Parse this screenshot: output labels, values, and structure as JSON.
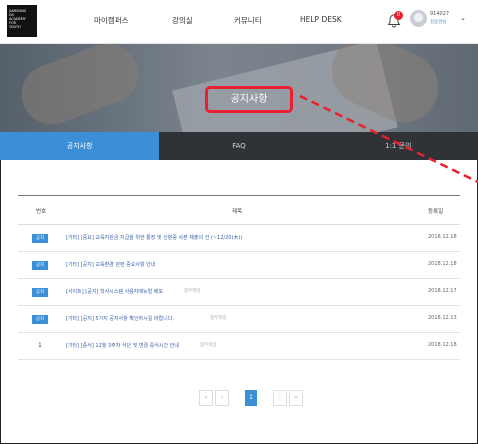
{
  "logo": {
    "lines": [
      "SAMSUNG",
      "DS",
      "ACADEMY",
      "FOR",
      "YOUTH"
    ]
  },
  "nav": {
    "items": [
      "마이캠퍼스",
      "강의실",
      "커뮤니티",
      "HELP DESK"
    ]
  },
  "user": {
    "notification_count": "0",
    "id": "914027",
    "name": "김승현님"
  },
  "hero": {
    "title": "공지사항"
  },
  "tabs": [
    "공지사항",
    "FAQ",
    "1:1 문의"
  ],
  "table": {
    "headers": {
      "num": "번호",
      "title": "제목",
      "date": "등록일"
    },
    "rows": [
      {
        "badge": "공지",
        "title": "[기타] [중요] 교육지원금 지급을 위한 통장 및 신분증 사본 제출의 건 (~12/20(木))",
        "attach": "",
        "date": "2018.12.18"
      },
      {
        "badge": "공지",
        "title": "[기타] [공지] 교육환경 관련 중요사항 안내",
        "attach": "",
        "date": "2018.12.18"
      },
      {
        "badge": "공지",
        "title": "[사이트] [공지] 학사시스템 사용자매뉴얼 배포",
        "attach": "첨부파일",
        "date": "2018.12.17"
      },
      {
        "badge": "공지",
        "title": "[기타] [공지] 5가지 공지사항 확인하시길 바랍니다.",
        "attach": "첨부파일",
        "date": "2018.12.13"
      },
      {
        "badge": "",
        "num": "1",
        "title": "[기타] [중식] 12월 3주차 식단 및 변경 중식시간 안내",
        "attach": "첨부파일",
        "date": "2018.12.18"
      }
    ]
  },
  "pager": {
    "first": "«",
    "prev": "‹",
    "current": "1",
    "next": "›",
    "last": "»"
  },
  "colors": {
    "accent": "#3b8fd6",
    "annotation": "#e8202f",
    "tabbar": "#2f3338"
  }
}
